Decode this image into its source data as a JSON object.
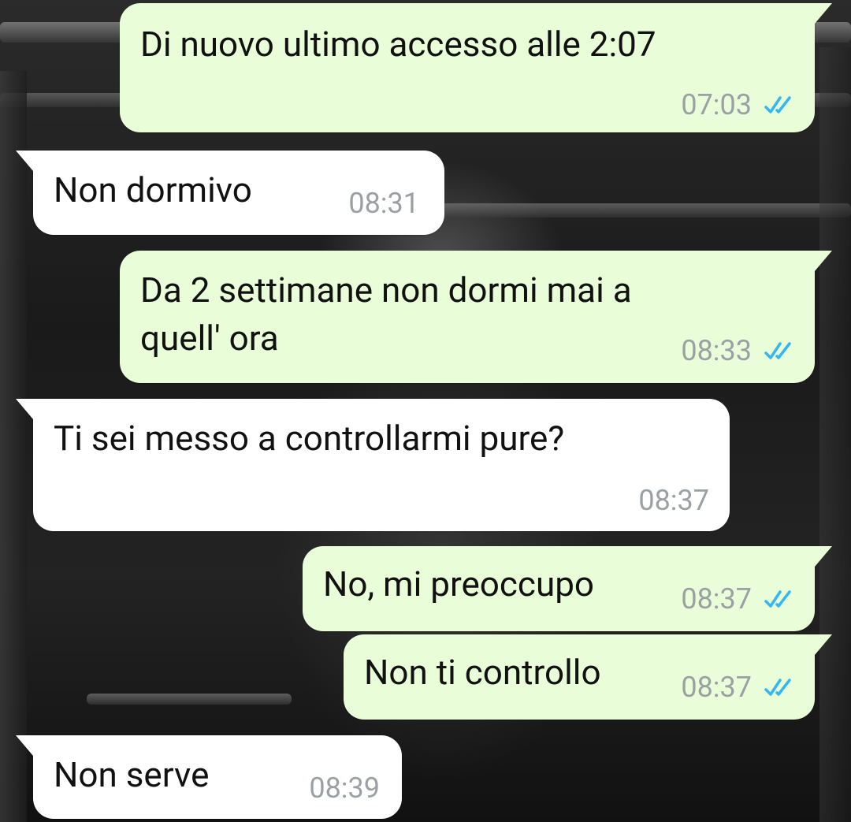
{
  "chat": {
    "colors": {
      "outgoing_bubble": "#e8fdd8",
      "incoming_bubble": "#ffffff",
      "read_ticks": "#34b7f1",
      "timestamp": "#9aa0a3"
    },
    "messages": [
      {
        "direction": "outgoing",
        "text": "Di nuovo ultimo accesso alle 2:07",
        "time": "07:03",
        "status": "read"
      },
      {
        "direction": "incoming",
        "text": "Non dormivo",
        "time": "08:31"
      },
      {
        "direction": "outgoing",
        "text": "Da 2 settimane non dormi mai a\nquell' ora",
        "time": "08:33",
        "status": "read"
      },
      {
        "direction": "incoming",
        "text": "Ti sei messo a controllarmi pure?",
        "time": "08:37"
      },
      {
        "direction": "outgoing",
        "text": "No, mi preoccupo",
        "time": "08:37",
        "status": "read"
      },
      {
        "direction": "outgoing",
        "text": "Non ti controllo",
        "time": "08:37",
        "status": "read"
      },
      {
        "direction": "incoming",
        "text": "Non serve",
        "time": "08:39"
      }
    ]
  }
}
